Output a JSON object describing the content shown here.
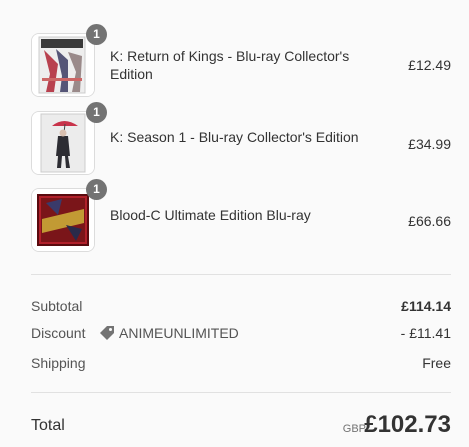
{
  "items": [
    {
      "name": "K: Return of Kings - Blu-ray Collector's Edition",
      "quantity": "1",
      "price": "£12.49",
      "image": "K Return of Kings box art"
    },
    {
      "name": "K: Season 1 - Blu-ray Collector's Edition",
      "quantity": "1",
      "price": "£34.99",
      "image": "K Season 1 box art"
    },
    {
      "name": "Blood-C Ultimate Edition Blu-ray",
      "quantity": "1",
      "price": "£66.66",
      "image": "Blood-C box art"
    }
  ],
  "summary": {
    "subtotal_label": "Subtotal",
    "subtotal_value": "£114.14",
    "discount_label": "Discount",
    "discount_code": "ANIMEUNLIMITED",
    "discount_value": "- £11.41",
    "shipping_label": "Shipping",
    "shipping_value": "Free",
    "total_label": "Total",
    "currency": "GBP",
    "total_value": "£102.73"
  },
  "icons": {
    "discount": "tag-icon"
  },
  "colors": {
    "badge": "#737373",
    "text": "#333333",
    "muted": "#545454",
    "divider": "#e1e1e1"
  }
}
